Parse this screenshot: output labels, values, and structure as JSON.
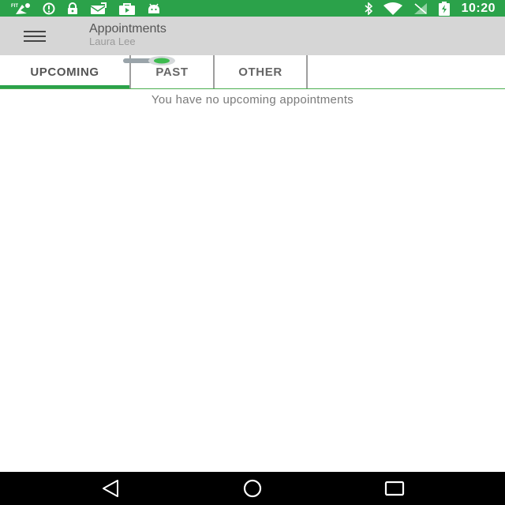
{
  "status_bar": {
    "background_color": "#2ba24a",
    "left_icons": [
      "fit-app-icon",
      "info-icon",
      "lock-icon",
      "mail-icon",
      "play-store-icon",
      "android-icon"
    ],
    "right_icons": [
      "bluetooth-icon",
      "wifi-icon",
      "no-signal-icon",
      "battery-charging-icon"
    ],
    "time": "10:20"
  },
  "app_bar": {
    "background_color": "#d6d6d6",
    "menu_icon": "hamburger-menu-icon",
    "title": "Appointments",
    "subtitle": "Laura Lee"
  },
  "tabs": [
    {
      "label": "UPCOMING",
      "selected": true
    },
    {
      "label": "PAST",
      "selected": false
    },
    {
      "label": "OTHER",
      "selected": false
    }
  ],
  "accent_color": "#2ba24a",
  "content": {
    "empty_message": "You have no upcoming appointments"
  },
  "nav_bar": {
    "icons": [
      "back-icon",
      "home-icon",
      "recents-icon"
    ]
  }
}
